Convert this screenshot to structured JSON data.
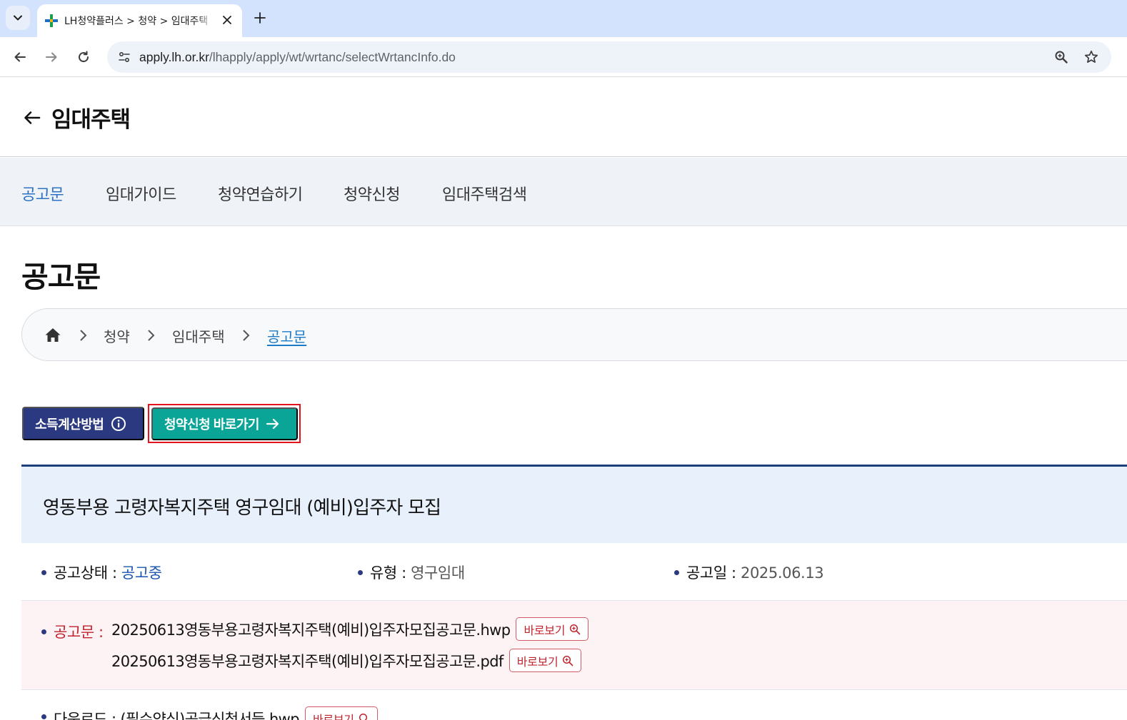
{
  "browser": {
    "tab_title": "LH청약플러스 > 청약 > 임대주택",
    "url_host": "apply.lh.or.kr",
    "url_path": "/lhapply/apply/wt/wrtanc/selectWrtancInfo.do"
  },
  "header": {
    "title": "임대주택"
  },
  "subnav": {
    "items": [
      {
        "label": "공고문",
        "active": true
      },
      {
        "label": "임대가이드",
        "active": false
      },
      {
        "label": "청약연습하기",
        "active": false
      },
      {
        "label": "청약신청",
        "active": false
      },
      {
        "label": "임대주택검색",
        "active": false
      }
    ]
  },
  "section": {
    "title": "공고문"
  },
  "breadcrumb": {
    "items": [
      "청약",
      "임대주택",
      "공고문"
    ]
  },
  "buttons": {
    "income_calc": "소득계산방법",
    "apply_shortcut": "청약신청 바로가기"
  },
  "notice": {
    "title": "영동부용 고령자복지주택 영구임대 (예비)입주자 모집",
    "status_label": "공고상태 :",
    "status_value": "공고중",
    "type_label": "유형 :",
    "type_value": "영구임대",
    "date_label": "공고일 :",
    "date_value": "2025.06.13",
    "files_label": "공고문 :",
    "files": [
      {
        "name": "20250613영동부용고령자복지주택(예비)입주자모집공고문.hwp",
        "view_label": "바로보기"
      },
      {
        "name": "20250613영동부용고령자복지주택(예비)입주자모집공고문.pdf",
        "view_label": "바로보기"
      }
    ],
    "next_line_text": "다운로드 : (필수양식)공급신청서등.hwp",
    "next_view_label": "바로보기"
  },
  "colors": {
    "accent_blue": "#2d73c4",
    "navy": "#2b3a80",
    "teal": "#0aa596",
    "highlight_red": "#e5131d",
    "file_red": "#c0242f"
  }
}
